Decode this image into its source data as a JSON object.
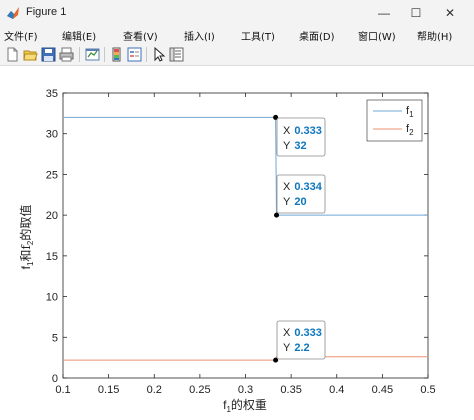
{
  "window": {
    "title": "Figure 1",
    "minimize_glyph": "—",
    "maximize_glyph": "☐",
    "close_glyph": "✕"
  },
  "menu": [
    {
      "label": "文件(F)"
    },
    {
      "label": "编辑(E)"
    },
    {
      "label": "查看(V)"
    },
    {
      "label": "插入(I)"
    },
    {
      "label": "工具(T)"
    },
    {
      "label": "桌面(D)"
    },
    {
      "label": "窗口(W)"
    },
    {
      "label": "帮助(H)"
    }
  ],
  "toolbar": {
    "icons": [
      "new-file-icon",
      "open-folder-icon",
      "save-icon",
      "print-icon",
      "link-plot-icon",
      "colorbar-icon",
      "legend-icon",
      "pointer-icon",
      "property-editor-icon"
    ]
  },
  "colors": {
    "f1": "#6fa8d6",
    "f2": "#ee9272",
    "datatip_value": "#0f76bd"
  },
  "datatips": [
    {
      "x_label": "X",
      "x_value": "0.333",
      "y_label": "Y",
      "y_value": "32"
    },
    {
      "x_label": "X",
      "x_value": "0.334",
      "y_label": "Y",
      "y_value": "20"
    },
    {
      "x_label": "X",
      "x_value": "0.333",
      "y_label": "Y",
      "y_value": "2.2"
    }
  ],
  "chart_data": {
    "type": "line",
    "xlabel": "f1的权重",
    "xlabel_parts": {
      "base": "f",
      "sub": "1",
      "rest": "的权重"
    },
    "ylabel": "f1和f2的取值",
    "ylabel_parts": {
      "b1": "f",
      "s1": "1",
      "mid": "和f",
      "s2": "2",
      "rest": "的取值"
    },
    "xlim": [
      0.1,
      0.5
    ],
    "ylim": [
      0,
      35
    ],
    "xticks": [
      "0.1",
      "0.15",
      "0.2",
      "0.25",
      "0.3",
      "0.35",
      "0.4",
      "0.45",
      "0.5"
    ],
    "yticks": [
      "0",
      "5",
      "10",
      "15",
      "20",
      "25",
      "30",
      "35"
    ],
    "legend_position": "top-right",
    "legend": [
      {
        "base": "f",
        "sub": "1"
      },
      {
        "base": "f",
        "sub": "2"
      }
    ],
    "series": [
      {
        "name": "f1",
        "x": [
          0.1,
          0.333,
          0.334,
          0.5
        ],
        "y": [
          32,
          32,
          20,
          20
        ]
      },
      {
        "name": "f2",
        "x": [
          0.1,
          0.333,
          0.334,
          0.5
        ],
        "y": [
          2.2,
          2.2,
          2.6,
          2.6
        ]
      }
    ],
    "markers": [
      {
        "x": 0.333,
        "y": 32
      },
      {
        "x": 0.334,
        "y": 20
      },
      {
        "x": 0.333,
        "y": 2.2
      }
    ]
  }
}
